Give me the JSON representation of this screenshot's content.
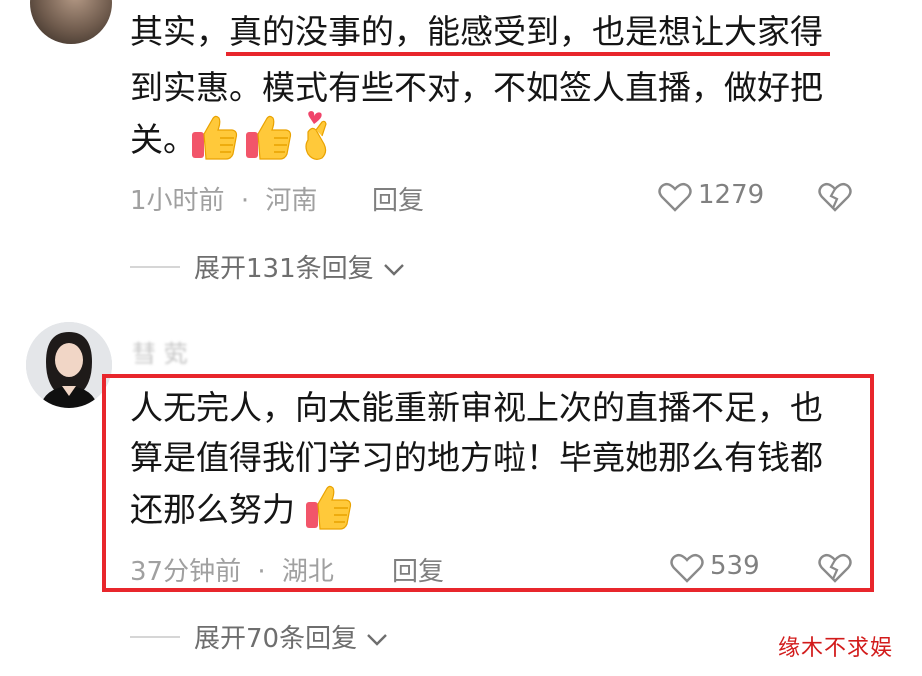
{
  "comment1": {
    "text_line1_part1": "其实，",
    "text_line1_part2": "真的没事的，能感受到，也是想让大家得",
    "text_line2": "到实惠。模式有些不对，不如签人直播，做好把",
    "text_line3": "关。",
    "time": "1小时前",
    "location": "河南",
    "reply_label": "回复",
    "like_count": "1279",
    "expand_label": "展开131条回复"
  },
  "comment2": {
    "username": "彗 䒯",
    "text_line1": "人无完人，向太能重新审视上次的直播不足，也",
    "text_line2": "算是值得我们学习的地方啦！毕竟她那么有钱都",
    "text_line3": "还那么努力",
    "time": "37分钟前",
    "location": "湖北",
    "reply_label": "回复",
    "like_count": "539",
    "expand_label": "展开70条回复"
  },
  "separator": "·",
  "watermark": "缘木不求娱",
  "colors": {
    "highlight": "#e8262c",
    "meta": "#a0a0a0",
    "text": "#151515"
  },
  "icons": [
    "heart-outline-icon",
    "broken-heart-icon",
    "thumbs-up-emoji",
    "finger-heart-emoji",
    "chevron-down-icon"
  ]
}
